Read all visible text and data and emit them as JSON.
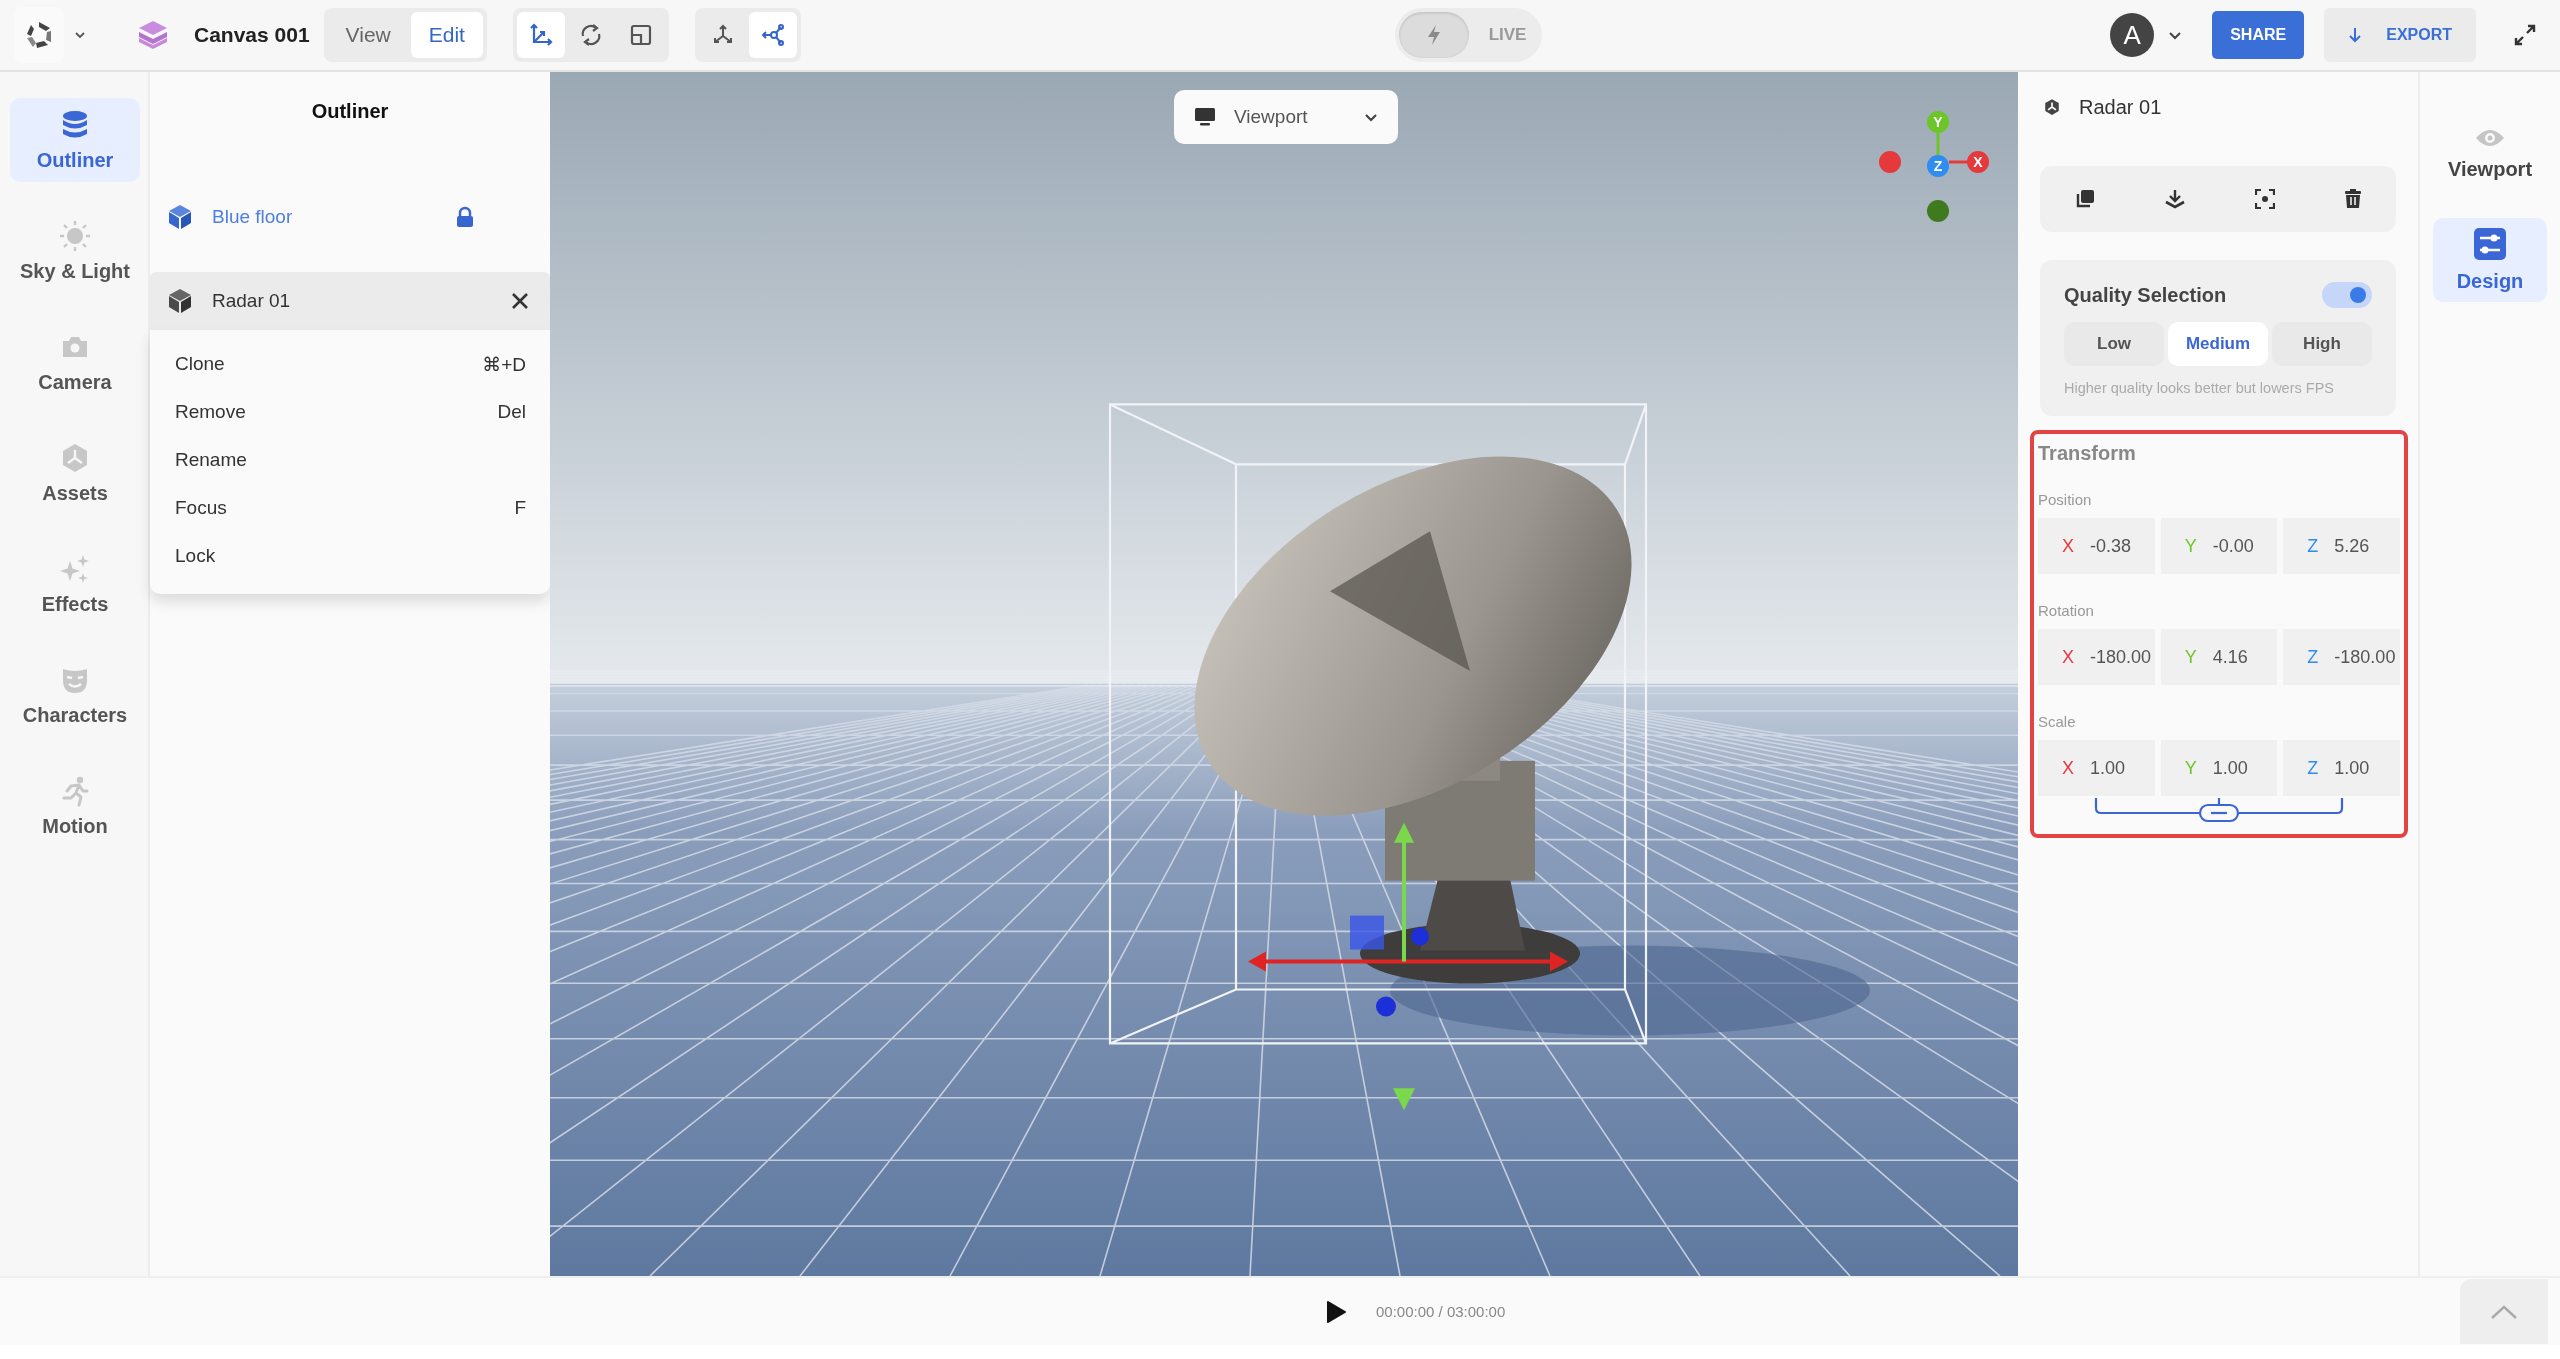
{
  "toolbar": {
    "doc_title": "Canvas 001",
    "mode_tabs": [
      {
        "label": "View",
        "selected": false
      },
      {
        "label": "Edit",
        "selected": true
      }
    ],
    "transform_tools": [
      {
        "kind": "move",
        "selected": true
      },
      {
        "kind": "rotate",
        "selected": false
      },
      {
        "kind": "scale",
        "selected": false
      }
    ],
    "space_tools": [
      {
        "kind": "world",
        "selected": false
      },
      {
        "kind": "local",
        "selected": true
      }
    ],
    "live": {
      "label": "LIVE",
      "on": false
    },
    "avatar": "A",
    "share": "SHARE",
    "export": "EXPORT"
  },
  "nav": [
    {
      "label": "Outliner",
      "kind": "layers",
      "selected": true
    },
    {
      "label": "Sky & Light",
      "kind": "sun",
      "selected": false
    },
    {
      "label": "Camera",
      "kind": "camera",
      "selected": false
    },
    {
      "label": "Assets",
      "kind": "assets",
      "selected": false
    },
    {
      "label": "Effects",
      "kind": "sparkle",
      "selected": false
    },
    {
      "label": "Characters",
      "kind": "mask",
      "selected": false
    },
    {
      "label": "Motion",
      "kind": "runner",
      "selected": false
    }
  ],
  "outliner": {
    "title": "Outliner",
    "items": [
      {
        "name": "Blue floor",
        "locked": true,
        "expanded": false
      },
      {
        "name": "Radar 01",
        "locked": false,
        "expanded": true
      }
    ],
    "context_menu": [
      {
        "label": "Clone",
        "shortcut": "⌘+D"
      },
      {
        "label": "Remove",
        "shortcut": "Del"
      },
      {
        "label": "Rename"
      },
      {
        "label": "Focus",
        "shortcut": "F"
      },
      {
        "label": "Lock"
      }
    ]
  },
  "viewport": {
    "view_select": "Viewport",
    "axes": [
      "X",
      "Y",
      "Z"
    ]
  },
  "inspector": {
    "title": "Radar 01",
    "actions": [
      {
        "kind": "duplicate"
      },
      {
        "kind": "drop"
      },
      {
        "kind": "focus"
      },
      {
        "kind": "delete"
      }
    ],
    "quality": {
      "title": "Quality Selection",
      "on": true,
      "options": [
        {
          "label": "Low",
          "selected": false
        },
        {
          "label": "Medium",
          "selected": true
        },
        {
          "label": "High",
          "selected": false
        }
      ],
      "hint": "Higher quality looks better but lowers FPS"
    },
    "transform": {
      "title": "Transform",
      "highlighted": true,
      "scale_linked": true,
      "groups": [
        {
          "label": "Position",
          "fields": [
            {
              "axis": "X",
              "value": "-0.38"
            },
            {
              "axis": "Y",
              "value": "-0.00"
            },
            {
              "axis": "Z",
              "value": "5.26"
            }
          ]
        },
        {
          "label": "Rotation",
          "fields": [
            {
              "axis": "X",
              "value": "-180.00"
            },
            {
              "axis": "Y",
              "value": "4.16"
            },
            {
              "axis": "Z",
              "value": "-180.00"
            }
          ]
        },
        {
          "label": "Scale",
          "fields": [
            {
              "axis": "X",
              "value": "1.00"
            },
            {
              "axis": "Y",
              "value": "1.00"
            },
            {
              "axis": "Z",
              "value": "1.00"
            }
          ]
        }
      ]
    }
  },
  "rail": [
    {
      "label": "Viewport",
      "kind": "eye",
      "selected": false
    },
    {
      "label": "Design",
      "kind": "sliders",
      "selected": true
    }
  ],
  "timeline": {
    "playing": false,
    "time": "00:00:00 / 03:00:00"
  }
}
